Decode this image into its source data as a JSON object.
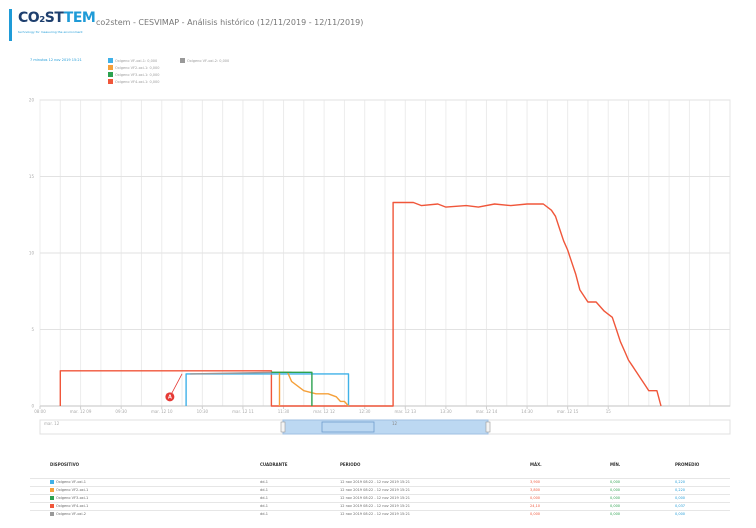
{
  "header": {
    "logo_main": "CO₂ST",
    "logo_accent": "TEM",
    "logo_tagline": "technology for measuring the environment",
    "title": "co2stem - CESVIMAP - Análisis histórico (12/11/2019 - 12/11/2019)"
  },
  "legend": {
    "range_label": "7 minutos 12 nov 2019 15:21",
    "items": [
      {
        "label": "Oxígeno VF-oxi-1: 0,000",
        "color": "#3fb1e8"
      },
      {
        "label": "Oxígeno VF-oxi-2: 0,000",
        "color": "#999999"
      },
      {
        "label": "Oxígeno VF2-oxi-1: 0,000",
        "color": "#f5a03a"
      },
      {
        "label": "Oxígeno VF3-oxi-1: 0,000",
        "color": "#2ca24f"
      },
      {
        "label": "Oxígeno VF4-oxi-1: 0,000",
        "color": "#f0563a"
      }
    ]
  },
  "chart_data": {
    "type": "line",
    "title": "",
    "xlabel": "",
    "ylabel": "",
    "ylim": [
      0,
      20
    ],
    "xlim": [
      0,
      17
    ],
    "y_ticks": [
      "0",
      "5",
      "10",
      "15",
      "20"
    ],
    "x_ticks": [
      {
        "x": 0,
        "label": "08:00"
      },
      {
        "x": 1,
        "label": "mar. 12 09"
      },
      {
        "x": 2,
        "label": "09:30"
      },
      {
        "x": 3,
        "label": "mar. 12 10"
      },
      {
        "x": 4,
        "label": "10:30"
      },
      {
        "x": 5,
        "label": "mar. 12 11"
      },
      {
        "x": 6,
        "label": "11:30"
      },
      {
        "x": 7,
        "label": "mar. 12 12"
      },
      {
        "x": 8,
        "label": "12:30"
      },
      {
        "x": 9,
        "label": "mar. 12 13"
      },
      {
        "x": 10,
        "label": "13:30"
      },
      {
        "x": 11,
        "label": "mar. 12 14"
      },
      {
        "x": 12,
        "label": "14:30"
      },
      {
        "x": 13,
        "label": "mar. 12 15"
      },
      {
        "x": 14,
        "label": "15"
      }
    ],
    "navigator": {
      "start_label": "mar. 12",
      "mid_label": "12"
    },
    "marker": {
      "label": "A",
      "x": 3.2,
      "y": 0.6
    },
    "grid": true,
    "series": [
      {
        "color": "#f0563a",
        "points": [
          [
            0.5,
            0
          ],
          [
            0.5,
            2.3
          ],
          [
            5.7,
            2.3
          ],
          [
            5.7,
            0
          ],
          [
            8.7,
            0
          ],
          [
            8.7,
            13.3
          ],
          [
            9.2,
            13.3
          ],
          [
            9.4,
            13.1
          ],
          [
            9.8,
            13.2
          ],
          [
            10.0,
            13.0
          ],
          [
            10.5,
            13.1
          ],
          [
            10.8,
            13.0
          ],
          [
            11.2,
            13.2
          ],
          [
            11.6,
            13.1
          ],
          [
            12.0,
            13.2
          ],
          [
            12.4,
            13.2
          ],
          [
            12.6,
            12.8
          ],
          [
            12.7,
            12.4
          ],
          [
            12.8,
            11.6
          ],
          [
            12.9,
            10.8
          ],
          [
            13.0,
            10.2
          ],
          [
            13.1,
            9.4
          ],
          [
            13.2,
            8.6
          ],
          [
            13.3,
            7.6
          ],
          [
            13.5,
            6.8
          ],
          [
            13.7,
            6.8
          ],
          [
            13.9,
            6.2
          ],
          [
            14.0,
            6.0
          ],
          [
            14.1,
            5.8
          ],
          [
            14.2,
            5.0
          ],
          [
            14.3,
            4.2
          ],
          [
            14.4,
            3.6
          ],
          [
            14.5,
            3.0
          ],
          [
            14.6,
            2.6
          ],
          [
            14.7,
            2.2
          ],
          [
            14.8,
            1.8
          ],
          [
            14.9,
            1.4
          ],
          [
            15.0,
            1.0
          ],
          [
            15.2,
            1.0
          ],
          [
            15.3,
            0
          ]
        ]
      },
      {
        "color": "#3fb1e8",
        "points": [
          [
            3.6,
            0
          ],
          [
            3.6,
            2.1
          ],
          [
            7.6,
            2.1
          ],
          [
            7.6,
            0
          ]
        ]
      },
      {
        "color": "#999999",
        "points": [
          [
            3.7,
            2.1
          ],
          [
            5.9,
            2.2
          ],
          [
            6.2,
            2.2
          ]
        ]
      },
      {
        "color": "#f5a03a",
        "points": [
          [
            5.9,
            0
          ],
          [
            5.9,
            2.2
          ],
          [
            6.1,
            2.2
          ],
          [
            6.2,
            1.6
          ],
          [
            6.5,
            1.0
          ],
          [
            6.8,
            0.8
          ],
          [
            7.1,
            0.8
          ],
          [
            7.3,
            0.6
          ],
          [
            7.4,
            0.3
          ],
          [
            7.5,
            0.3
          ],
          [
            7.6,
            0
          ]
        ]
      },
      {
        "color": "#2ca24f",
        "points": [
          [
            5.7,
            2.2
          ],
          [
            6.7,
            2.2
          ],
          [
            6.7,
            0
          ]
        ]
      }
    ]
  },
  "table": {
    "headers": [
      "DISPOSITIVO",
      "CUADRANTE",
      "PERIODO",
      "MÁX.",
      "MÍN.",
      "PROMEDIO"
    ],
    "rows": [
      {
        "device": "Oxígeno VF-oxi-1",
        "color": "#3fb1e8",
        "quadrant": "dd-1",
        "period": "12 nov 2019 08:22 - 12 nov 2019 15:21",
        "max": "3,900",
        "min": "0,000",
        "avg": "0,220"
      },
      {
        "device": "Oxígeno VF2-oxi-1",
        "color": "#f5a03a",
        "quadrant": "dd-1",
        "period": "12 nov 2019 08:22 - 12 nov 2019 15:21",
        "max": "3,800",
        "min": "0,000",
        "avg": "0,220"
      },
      {
        "device": "Oxígeno VF3-oxi-1",
        "color": "#2ca24f",
        "quadrant": "dd-1",
        "period": "12 nov 2019 08:22 - 12 nov 2019 15:21",
        "max": "0,000",
        "min": "0,000",
        "avg": "0,000"
      },
      {
        "device": "Oxígeno VF4-oxi-1",
        "color": "#f0563a",
        "quadrant": "dd-1",
        "period": "12 nov 2019 08:22 - 12 nov 2019 15:21",
        "max": "24,10",
        "min": "0,000",
        "avg": "0,037"
      },
      {
        "device": "Oxígeno VF-oxi-2",
        "color": "#999999",
        "quadrant": "dd-1",
        "period": "12 nov 2019 08:22 - 12 nov 2019 15:21",
        "max": "0,000",
        "min": "0,000",
        "avg": "0,000"
      }
    ]
  }
}
